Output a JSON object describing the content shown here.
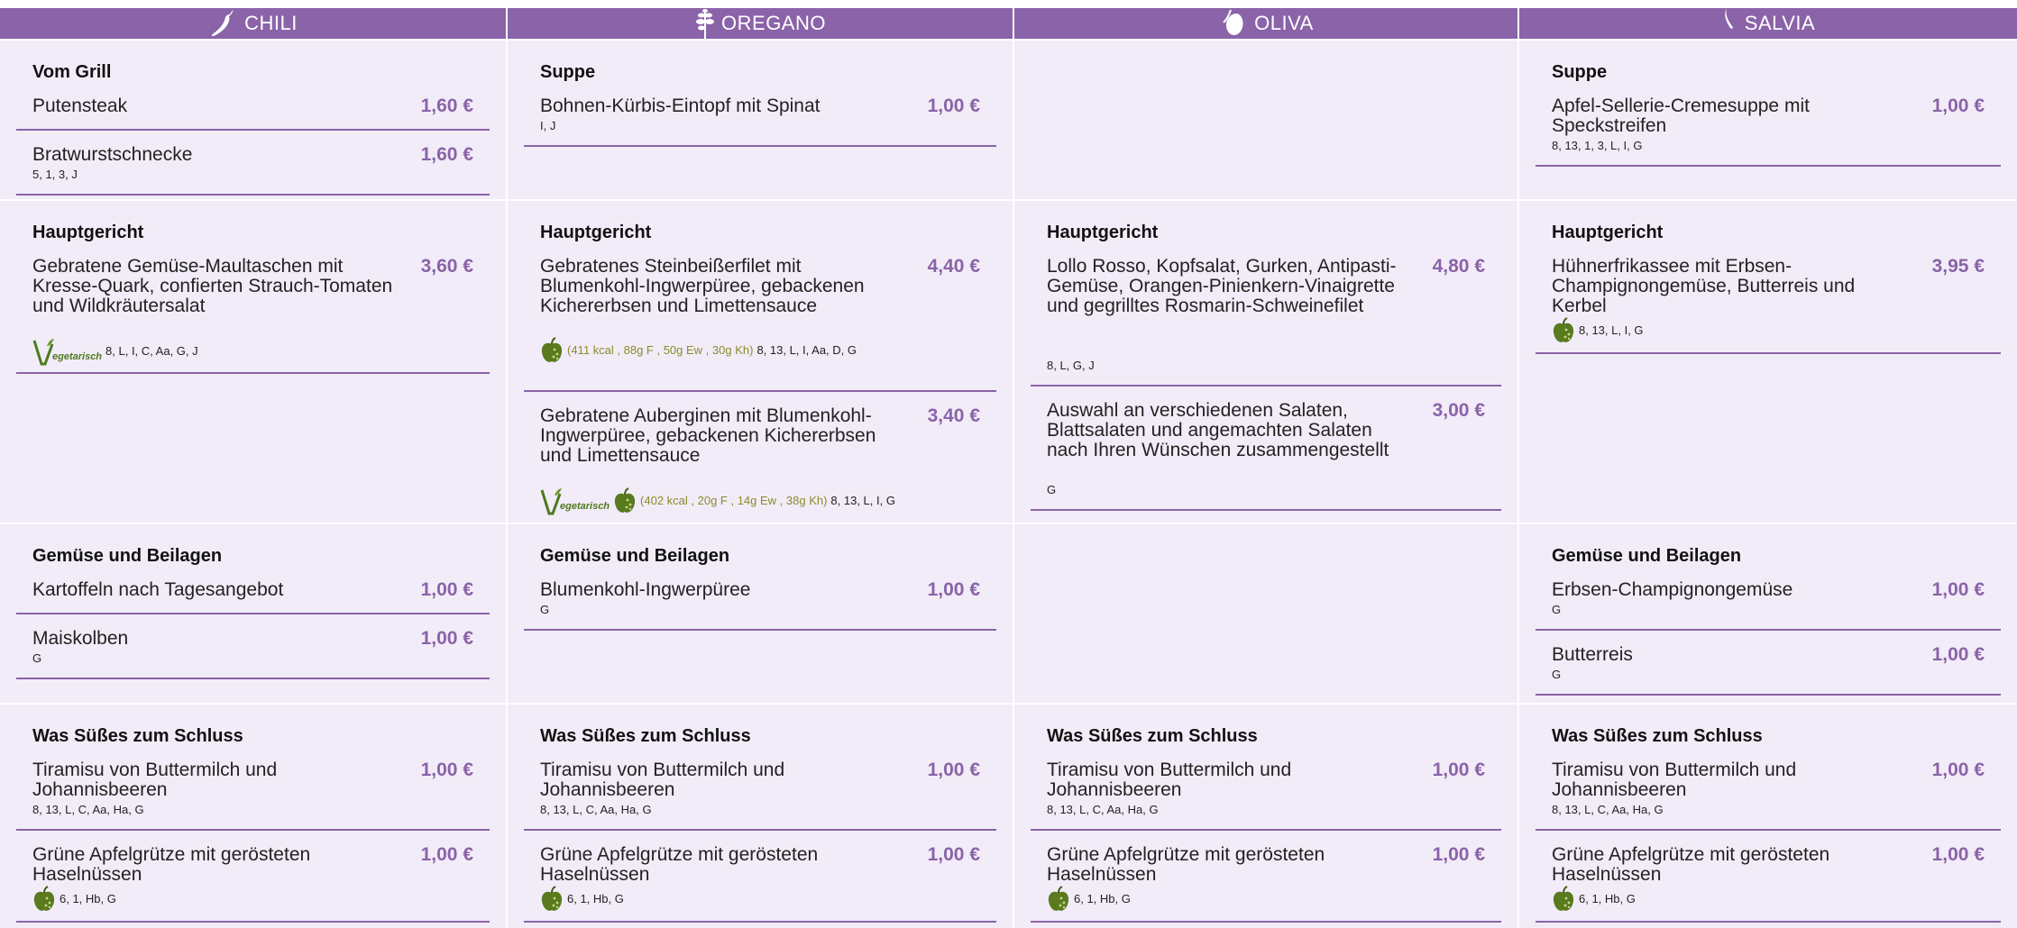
{
  "columns": [
    {
      "name": "CHILI",
      "icon": "chili-icon"
    },
    {
      "name": "OREGANO",
      "icon": "oregano-icon"
    },
    {
      "name": "OLIVA",
      "icon": "olive-icon"
    },
    {
      "name": "SALVIA",
      "icon": "sage-icon"
    }
  ],
  "labels": {
    "vegetarisch": "egetarisch"
  },
  "rows": [
    [
      {
        "title": "Vom Grill",
        "items": [
          {
            "name": "Putensteak",
            "price": "1,60 €",
            "allergens": ""
          },
          {
            "name": "Bratwurstschnecke",
            "price": "1,60 €",
            "allergens": "5, 1, 3, J"
          }
        ]
      },
      {
        "title": "Suppe",
        "items": [
          {
            "name": "Bohnen-Kürbis-Eintopf mit Spinat",
            "price": "1,00 €",
            "allergens": "I, J"
          }
        ]
      },
      {
        "title": "",
        "items": []
      },
      {
        "title": "Suppe",
        "items": [
          {
            "name": "Apfel-Sellerie-Cremesuppe mit Speckstreifen",
            "price": "1,00 €",
            "allergens": "8, 13, 1, 3, L, I, G"
          }
        ]
      }
    ],
    [
      {
        "title": "Hauptgericht",
        "items": [
          {
            "name": "Gebratene Gemüse-Maultaschen mit Kresse-Quark, confierten Strauch-Tomaten und Wildkräutersalat",
            "price": "3,60 €",
            "allergens": "8, L, I, C, Aa, G, J",
            "vegetarian": true
          }
        ]
      },
      {
        "title": "Hauptgericht",
        "items": [
          {
            "name": "Gebratenes Steinbeißerfilet mit Blumenkohl-Ingwerpüree, gebackenen Kichererbsen und Limettensauce",
            "price": "4,40 €",
            "nutrition": "(411 kcal , 88g F , 50g Ew , 30g Kh)",
            "allergens": "8, 13, L, I, Aa, D, G",
            "apple": true
          },
          {
            "name": "Gebratene Auberginen mit Blumenkohl-Ingwerpüree, gebackenen Kichererbsen und Limettensauce",
            "price": "3,40 €",
            "nutrition": "(402 kcal , 20g F , 14g Ew , 38g Kh)",
            "allergens": "8, 13, L, I, G",
            "apple": true,
            "vegetarian": true
          }
        ]
      },
      {
        "title": "Hauptgericht",
        "items": [
          {
            "name": "Lollo Rosso, Kopfsalat, Gurken, Antipasti-Gemüse, Orangen-Pinienkern-Vinaigrette und gegrilltes Rosmarin-Schweinefilet",
            "price": "4,80 €",
            "allergens": "8, L, G, J"
          },
          {
            "name": "Auswahl an verschiedenen Salaten, Blattsalaten und angemachten Salaten nach Ihren Wünschen zusammengestellt",
            "price": "3,00 €",
            "allergens": "G"
          }
        ]
      },
      {
        "title": "Hauptgericht",
        "items": [
          {
            "name": "Hühnerfrikassee mit Erbsen-Champignongemüse, Butterreis und Kerbel",
            "price": "3,95 €",
            "allergens": "8, 13, L, I, G",
            "apple": true
          }
        ]
      }
    ],
    [
      {
        "title": "Gemüse und Beilagen",
        "items": [
          {
            "name": "Kartoffeln nach Tagesangebot",
            "price": "1,00 €",
            "allergens": ""
          },
          {
            "name": "Maiskolben",
            "price": "1,00 €",
            "allergens": "G"
          }
        ]
      },
      {
        "title": "Gemüse und Beilagen",
        "items": [
          {
            "name": "Blumenkohl-Ingwerpüree",
            "price": "1,00 €",
            "allergens": "G"
          }
        ]
      },
      {
        "title": "",
        "items": []
      },
      {
        "title": "Gemüse und Beilagen",
        "items": [
          {
            "name": "Erbsen-Champignongemüse",
            "price": "1,00 €",
            "allergens": "G"
          },
          {
            "name": "Butterreis",
            "price": "1,00 €",
            "allergens": "G"
          }
        ]
      }
    ],
    [
      {
        "title": "Was Süßes zum Schluss",
        "items": [
          {
            "name": "Tiramisu von Buttermilch und Johannisbeeren",
            "price": "1,00 €",
            "allergens": "8, 13, L, C, Aa, Ha, G"
          },
          {
            "name": "Grüne Apfelgrütze mit gerösteten Haselnüssen",
            "price": "1,00 €",
            "allergens": "6, 1, Hb, G",
            "apple": true
          }
        ]
      },
      {
        "title": "Was Süßes zum Schluss",
        "items": [
          {
            "name": "Tiramisu von Buttermilch und Johannisbeeren",
            "price": "1,00 €",
            "allergens": "8, 13, L, C, Aa, Ha, G"
          },
          {
            "name": "Grüne Apfelgrütze mit gerösteten Haselnüssen",
            "price": "1,00 €",
            "allergens": "6, 1, Hb, G",
            "apple": true
          }
        ]
      },
      {
        "title": "Was Süßes zum Schluss",
        "items": [
          {
            "name": "Tiramisu von Buttermilch und Johannisbeeren",
            "price": "1,00 €",
            "allergens": "8, 13, L, C, Aa, Ha, G"
          },
          {
            "name": "Grüne Apfelgrütze mit gerösteten Haselnüssen",
            "price": "1,00 €",
            "allergens": "6, 1, Hb, G",
            "apple": true
          }
        ]
      },
      {
        "title": "Was Süßes zum Schluss",
        "items": [
          {
            "name": "Tiramisu von Buttermilch und Johannisbeeren",
            "price": "1,00 €",
            "allergens": "8, 13, L, C, Aa, Ha, G"
          },
          {
            "name": "Grüne Apfelgrütze mit gerösteten Haselnüssen",
            "price": "1,00 €",
            "allergens": "6, 1, Hb, G",
            "apple": true
          }
        ]
      }
    ]
  ],
  "colors": {
    "accent": "#8a63a8",
    "cell_bg": "#f2ecf8",
    "nutrition": "#8b8b2a",
    "veg_green": "#4e7a1e"
  }
}
